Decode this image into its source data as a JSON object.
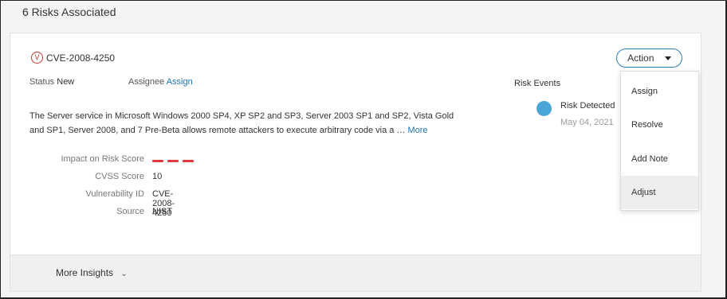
{
  "header": {
    "title": "6 Risks Associated"
  },
  "risk": {
    "badge": "V",
    "cve_id": "CVE-2008-4250",
    "status_label": "Status",
    "status_value": "New",
    "assignee_label": "Assignee",
    "assignee_link": "Assign",
    "description": "The Server service in Microsoft Windows 2000 SP4, XP SP2 and SP3, Server 2003 SP1 and SP2, Vista Gold and SP1, Server 2008, and 7 Pre-Beta allows remote attackers to execute arbitrary code via a …",
    "more_link": "More",
    "details": {
      "impact_label": "Impact on Risk Score",
      "impact_level": 3,
      "impact_color": "#e03a3e",
      "cvss_label": "CVSS Score",
      "cvss_value": "10",
      "vuln_id_label": "Vulnerability ID",
      "vuln_id_value": "CVE-2008-4250",
      "source_label": "Source",
      "source_value": "NIST"
    }
  },
  "risk_events": {
    "title": "Risk Events",
    "events": [
      {
        "label": "Risk Detected",
        "date": "May 04, 2021",
        "color": "#4aa6d6"
      }
    ]
  },
  "action_menu": {
    "button_label": "Action",
    "items": [
      {
        "label": "Assign"
      },
      {
        "label": "Resolve"
      },
      {
        "label": "Add Note"
      },
      {
        "label": "Adjust",
        "highlighted": true
      }
    ]
  },
  "footer": {
    "more_insights_label": "More Insights"
  },
  "colors": {
    "link": "#1a73b8",
    "accent_border": "#2d7fb8",
    "badge_red": "#c0392b"
  }
}
